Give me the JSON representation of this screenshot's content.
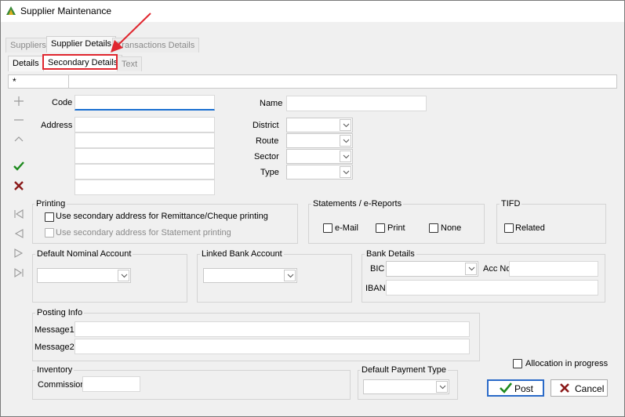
{
  "window": {
    "title": "Supplier Maintenance"
  },
  "tabs": {
    "top": [
      "Suppliers",
      "Supplier Details",
      "Transactions Details"
    ],
    "sub": [
      "Details",
      "Secondary Details",
      "Text"
    ]
  },
  "grid": {
    "first_cell": "*"
  },
  "form": {
    "code_label": "Code",
    "address_label": "Address",
    "name_label": "Name",
    "district_label": "District",
    "route_label": "Route",
    "sector_label": "Sector",
    "type_label": "Type"
  },
  "printing": {
    "title": "Printing",
    "opt1": "Use secondary address for Remittance/Cheque printing",
    "opt2": "Use secondary address for Statement printing"
  },
  "statements": {
    "title": "Statements / e-Reports",
    "email": "e-Mail",
    "print": "Print",
    "none": "None"
  },
  "tifd": {
    "title": "TIFD",
    "related": "Related"
  },
  "nominal": {
    "title": "Default Nominal Account"
  },
  "linked_bank": {
    "title": "Linked Bank Account"
  },
  "bank": {
    "title": "Bank Details",
    "bic_label": "BIC",
    "accno_label": "Acc No",
    "iban_label": "IBAN"
  },
  "posting": {
    "title": "Posting Info",
    "message1_label": "Message1",
    "message2_label": "Message2"
  },
  "inventory": {
    "title": "Inventory",
    "commission_label": "Commission"
  },
  "payment": {
    "title": "Default Payment Type"
  },
  "allocation": {
    "label": "Allocation in progress"
  },
  "buttons": {
    "post": "Post",
    "cancel": "Cancel"
  },
  "colors": {
    "highlight": "#e0262e",
    "focus": "#1a6fd1",
    "check_green": "#1e8a1e",
    "cross_red": "#8b1a1a"
  }
}
